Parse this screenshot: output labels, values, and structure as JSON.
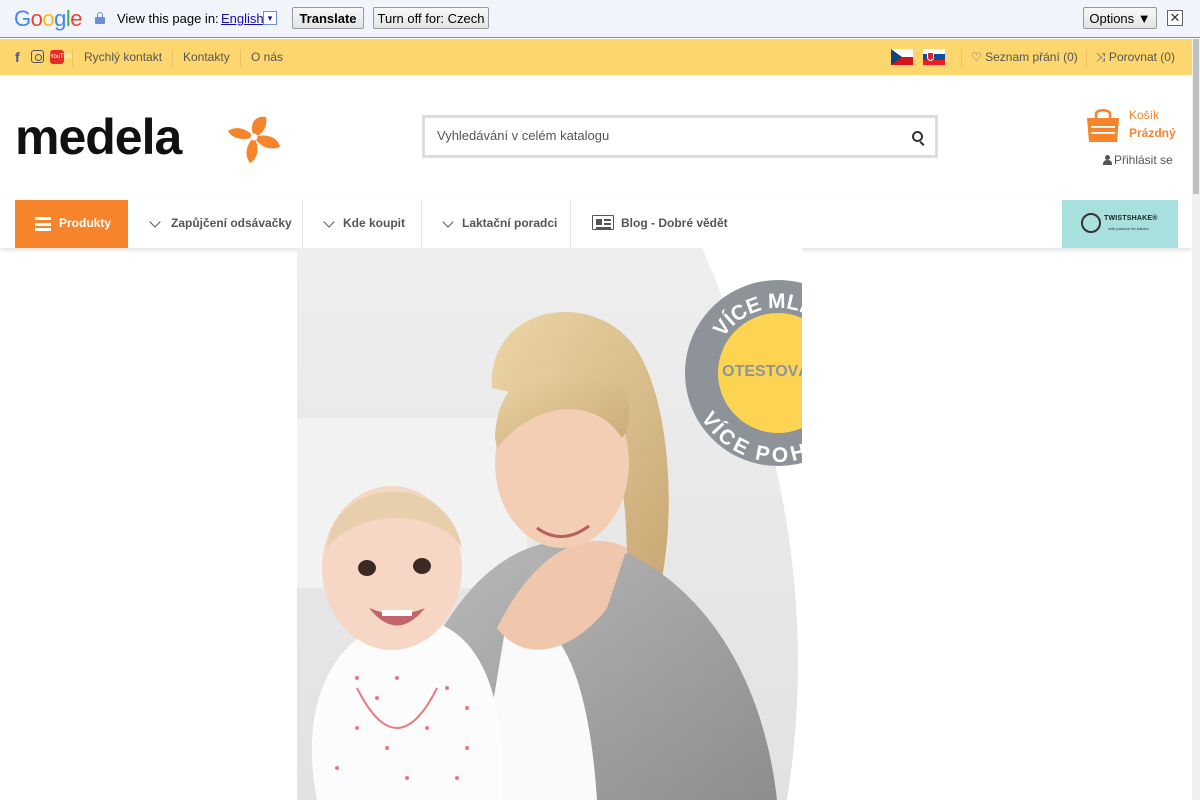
{
  "translate_bar": {
    "logo_letters": [
      "G",
      "o",
      "o",
      "g",
      "l",
      "e"
    ],
    "view_text": "View this page in:",
    "language": "English",
    "dropdown_glyph": "▾",
    "translate_label": "Translate",
    "turn_off_label": "Turn off for: Czech",
    "options_label": "Options ▼",
    "close_glyph": "✕"
  },
  "topbar": {
    "social": [
      "facebook-icon",
      "instagram-icon",
      "youtube-icon"
    ],
    "fb_glyph": "f",
    "yt_glyph": "YouTube",
    "links": {
      "quick_contact": "Rychlý kontakt",
      "contacts": "Kontakty",
      "about": "O nás"
    },
    "wishlist": "♡ Seznam přání (0)",
    "compare": "⤨ Porovnat (0)"
  },
  "header": {
    "logo_text": "medela",
    "search_placeholder": "Vyhledávání v celém katalogu",
    "cart_label": "Košík",
    "cart_status": "Prázdný",
    "login_label": "Přihlásit se"
  },
  "nav": {
    "products": "Produkty",
    "items": [
      {
        "label": "Zapůjčení odsávačky"
      },
      {
        "label": "Kde koupit"
      },
      {
        "label": "Laktační poradci"
      }
    ],
    "blog": "Blog - Dobré vědět",
    "partner_name": "TWISTSHAKE®",
    "partner_tagline": "with passion for babies"
  },
  "hero": {
    "badge_top": "VÍCE MLÉKA",
    "badge_center": "OTESTOVÁNO",
    "badge_bottom": "VÍCE POHODLÍ"
  },
  "colors": {
    "accent_orange": "#f5842b",
    "topbar_yellow": "#fdd76e",
    "badge_grey": "#8d9398",
    "badge_yellow": "#fdd452"
  }
}
